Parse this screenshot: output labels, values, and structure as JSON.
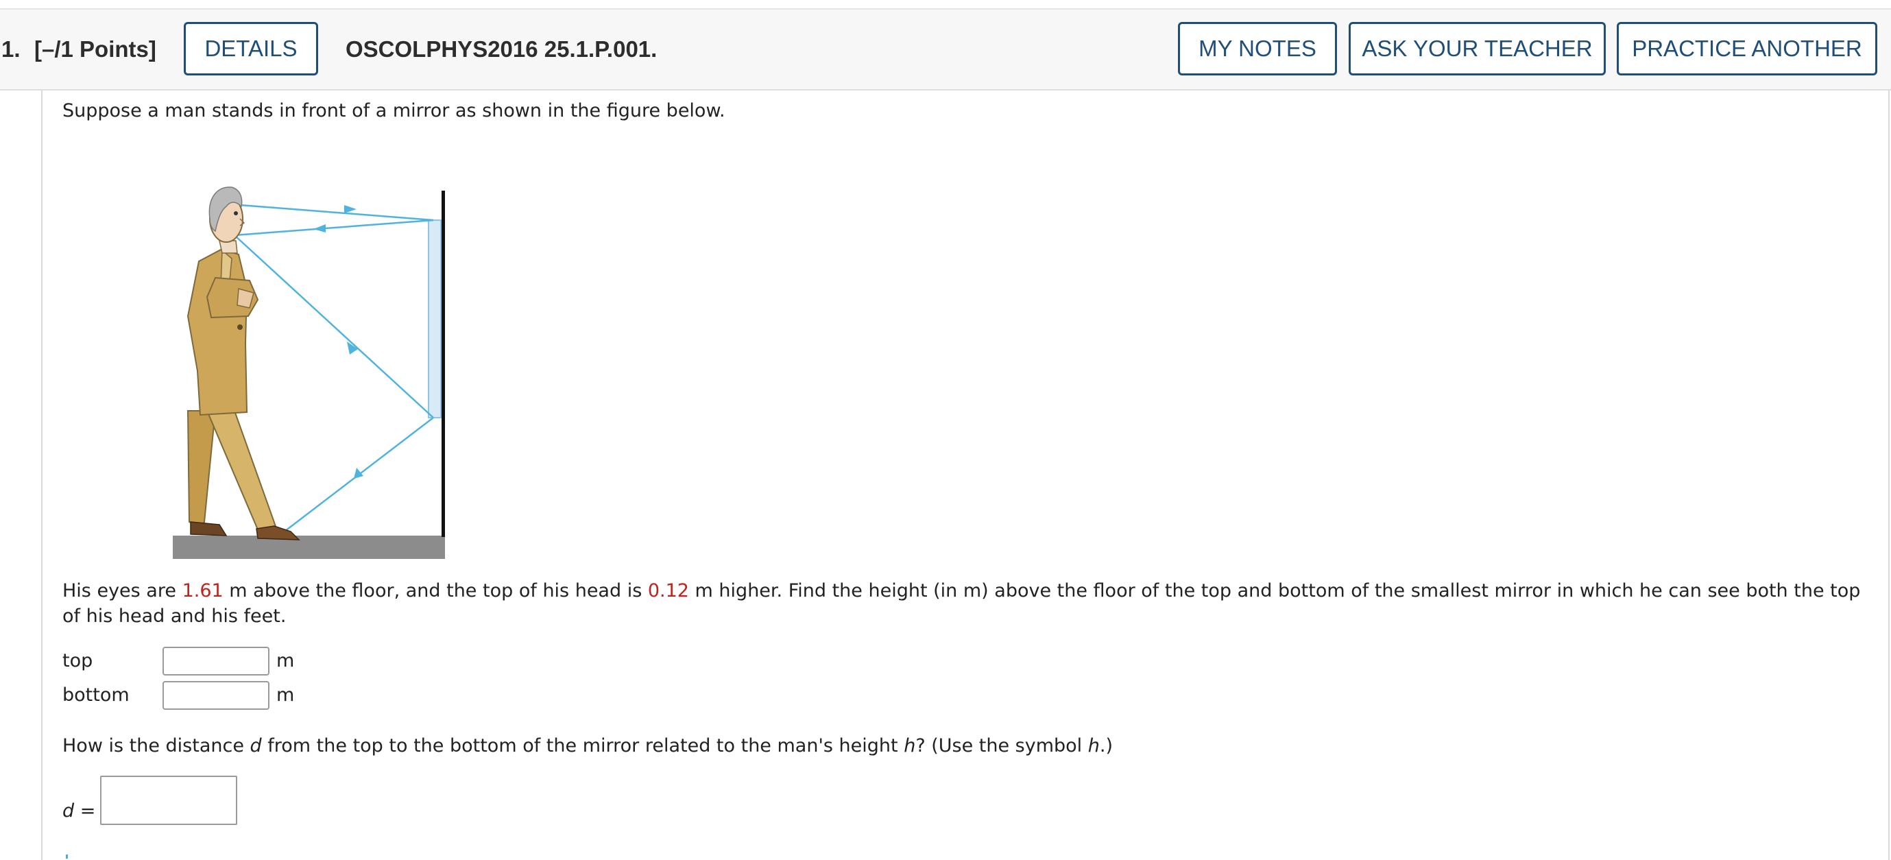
{
  "header": {
    "question_number": "1.",
    "points": "[–/1 Points]",
    "details_label": "DETAILS",
    "problem_id": "OSCOLPHYS2016 25.1.P.001.",
    "my_notes_label": "MY NOTES",
    "ask_teacher_label": "ASK YOUR TEACHER",
    "practice_another_label": "PRACTICE ANOTHER"
  },
  "question": {
    "intro": "Suppose a man stands in front of a mirror as shown in the figure below.",
    "p1_a": "His eyes are ",
    "eye_height": "1.61",
    "p1_b": " m above the floor, and the top of his head is ",
    "head_extra": "0.12",
    "p1_c": " m higher. Find the height (in m) above the floor of the top and bottom of the smallest mirror in which he can see both the top of his head and his feet.",
    "top_label": "top",
    "bottom_label": "bottom",
    "unit": "m",
    "top_value": "",
    "bottom_value": "",
    "q2_a": "How is the distance ",
    "q2_d": "d",
    "q2_b": " from the top to the bottom of the mirror related to the man's height ",
    "q2_h": "h",
    "q2_c": "? (Use the symbol ",
    "q2_h2": "h",
    "q2_d_end": ".)",
    "d_label_var": "d",
    "d_label_eq": " =",
    "d_value": ""
  },
  "colors": {
    "button_border": "#1f4e79",
    "given_value": "#c0231c",
    "ray": "#4fb3df",
    "suit": "#cda659",
    "floor": "#8c8c8c"
  }
}
